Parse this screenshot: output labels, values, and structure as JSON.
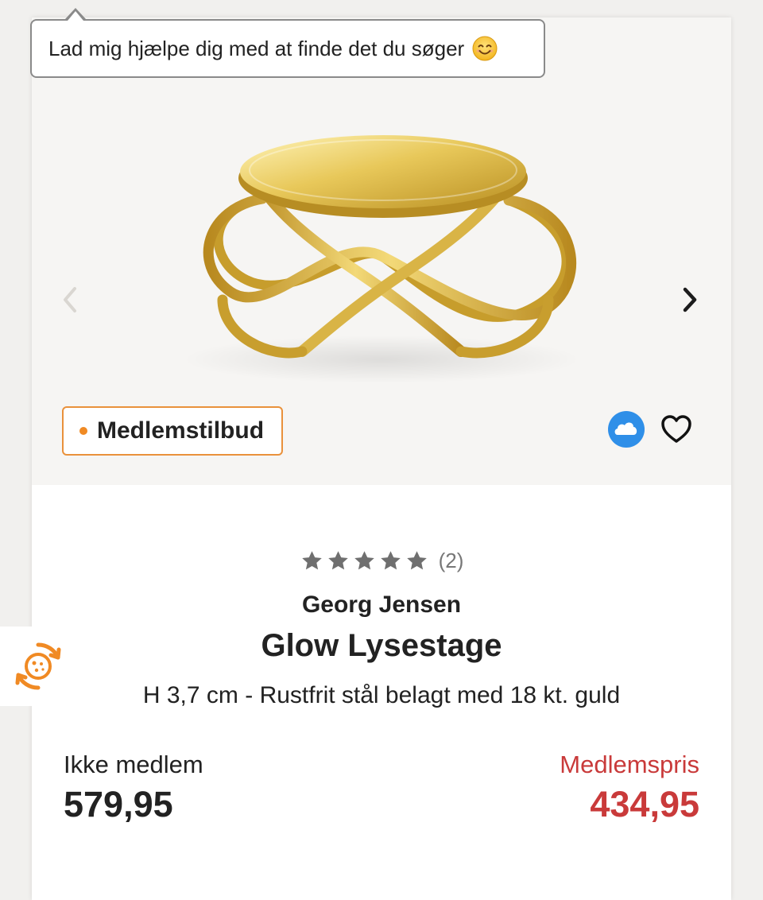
{
  "tooltip": {
    "text": "Lad mig hjælpe dig med at finde det du søger",
    "emoji_icon": "smiling-face-icon"
  },
  "carousel": {
    "prev_icon": "chevron-left-icon",
    "next_icon": "chevron-right-icon",
    "image_icon": "gold-candle-holder-image"
  },
  "badge": {
    "label": "Medlemstilbud"
  },
  "actions": {
    "cloud_icon": "cloud-icon",
    "wishlist_icon": "heart-icon"
  },
  "rating": {
    "stars": 5,
    "count_text": "(2)"
  },
  "product": {
    "brand": "Georg Jensen",
    "name": "Glow Lysestage",
    "description": "H 3,7 cm - Rustfrit stål belagt med 18 kt. guld"
  },
  "pricing": {
    "non_member_label": "Ikke medlem",
    "non_member_price": "579,95",
    "member_label": "Medlemspris",
    "member_price": "434,95"
  },
  "side_widget": {
    "icon": "cookie-settings-icon"
  },
  "colors": {
    "accent_orange": "#e9913b",
    "member_price_red": "#c93a3a",
    "cloud_blue": "#2f8fe8",
    "gold": "#d6b13f"
  }
}
